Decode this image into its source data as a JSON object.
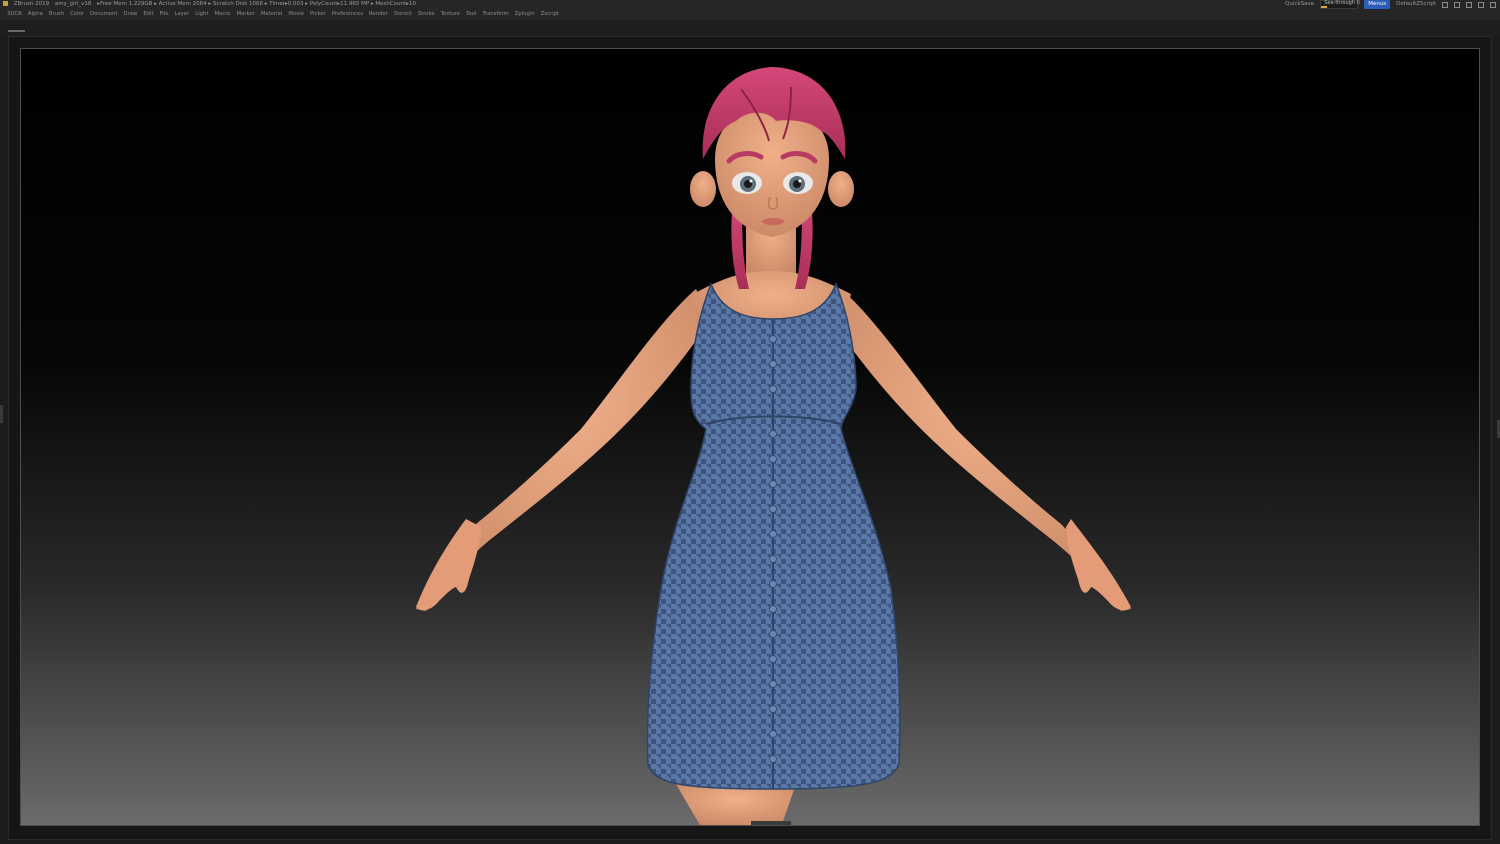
{
  "titlebar": {
    "app": "ZBrush 2019",
    "file": "amy_girl_v18",
    "stats": "▸Free Mem 1.229GB ▸ Active Mem 2064 ▸ Scratch Disk 1068 ▸ Timer▸0.003 ▸ PolyCount▸11.965 MP ▸ MeshCount▸10",
    "quicksave": "QuickSave",
    "see_through_label": "See-through  0",
    "see_through_value": 0,
    "menus_label": "Menus",
    "script_label": "DefaultZScript"
  },
  "menubar": {
    "items": [
      "3DCR",
      "Alpha",
      "Brush",
      "Color",
      "Document",
      "Draw",
      "Edit",
      "File",
      "Layer",
      "Light",
      "Macro",
      "Marker",
      "Material",
      "Movie",
      "Picker",
      "Preferences",
      "Render",
      "Stencil",
      "Stroke",
      "Texture",
      "Tool",
      "Transform",
      "Zplugin",
      "Zscript"
    ]
  },
  "colors": {
    "accent_menus": "#2c5db8",
    "slider_fill": "#d6a93a",
    "dress": "#4e6a96",
    "skin": "#e3a07c",
    "hair": "#c43a64"
  }
}
